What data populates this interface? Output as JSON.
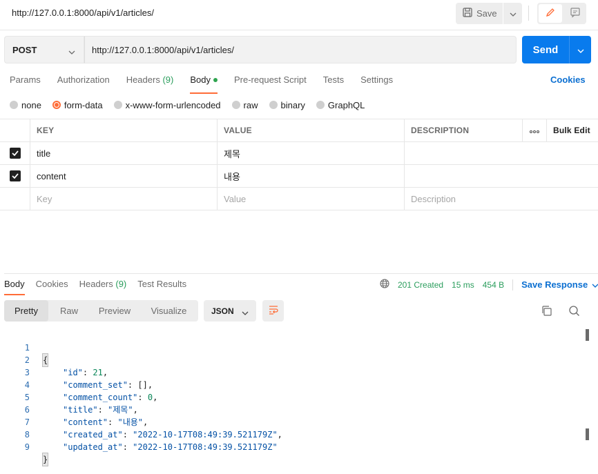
{
  "header": {
    "title": "http://127.0.0.1:8000/api/v1/articles/",
    "save_label": "Save"
  },
  "request": {
    "method": "POST",
    "url": "http://127.0.0.1:8000/api/v1/articles/",
    "send_label": "Send"
  },
  "req_tabs": {
    "params": "Params",
    "authorization": "Authorization",
    "headers": "Headers",
    "headers_count": "(9)",
    "body": "Body",
    "prerequest": "Pre-request Script",
    "tests": "Tests",
    "settings": "Settings",
    "cookies": "Cookies"
  },
  "body_types": {
    "none": "none",
    "form_data": "form-data",
    "urlencoded": "x-www-form-urlencoded",
    "raw": "raw",
    "binary": "binary",
    "graphql": "GraphQL",
    "selected": "form-data"
  },
  "table": {
    "headers": {
      "key": "KEY",
      "value": "VALUE",
      "description": "DESCRIPTION",
      "more": "ooo",
      "bulk_edit": "Bulk Edit"
    },
    "rows": [
      {
        "checked": true,
        "key": "title",
        "value": "제목",
        "description": ""
      },
      {
        "checked": true,
        "key": "content",
        "value": "내용",
        "description": ""
      }
    ],
    "placeholders": {
      "key": "Key",
      "value": "Value",
      "description": "Description"
    }
  },
  "response": {
    "tabs": {
      "body": "Body",
      "cookies": "Cookies",
      "headers": "Headers",
      "headers_count": "(9)",
      "test_results": "Test Results"
    },
    "status": "201 Created",
    "time": "15 ms",
    "size": "454 B",
    "save_response": "Save Response",
    "views": {
      "pretty": "Pretty",
      "raw": "Raw",
      "preview": "Preview",
      "visualize": "Visualize"
    },
    "format": "JSON"
  },
  "code": {
    "line_numbers": [
      "1",
      "2",
      "3",
      "4",
      "5",
      "6",
      "7",
      "8",
      "9"
    ],
    "open_brace": "{",
    "close_brace": "}",
    "fields": [
      {
        "key": "\"id\"",
        "value": "21",
        "type": "number",
        "comma": ","
      },
      {
        "key": "\"comment_set\"",
        "value": "[]",
        "type": "plain",
        "comma": ","
      },
      {
        "key": "\"comment_count\"",
        "value": "0",
        "type": "number",
        "comma": ","
      },
      {
        "key": "\"title\"",
        "value": "\"제목\"",
        "type": "string",
        "comma": ","
      },
      {
        "key": "\"content\"",
        "value": "\"내용\"",
        "type": "string",
        "comma": ","
      },
      {
        "key": "\"created_at\"",
        "value": "\"2022-10-17T08:49:39.521179Z\"",
        "type": "string",
        "comma": ","
      },
      {
        "key": "\"updated_at\"",
        "value": "\"2022-10-17T08:49:39.521179Z\"",
        "type": "string",
        "comma": ""
      }
    ]
  },
  "colors": {
    "accent": "#ff6c37",
    "send": "#097bed",
    "link": "#0b6fd1",
    "status_ok": "#2a9d5c"
  },
  "icons": [
    "save-icon",
    "chevron-down-icon",
    "pencil-icon",
    "comment-icon",
    "globe-icon",
    "wrap-lines-icon",
    "copy-icon",
    "search-icon",
    "checkbox-checked-icon"
  ]
}
